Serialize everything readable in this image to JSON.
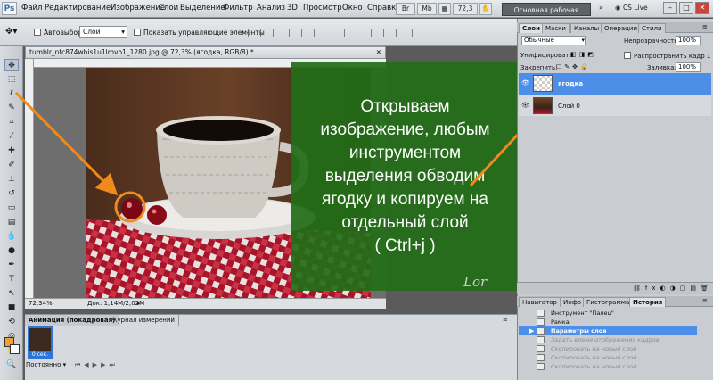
{
  "app": {
    "logo": "Ps"
  },
  "menu": [
    "Файл",
    "Редактирование",
    "Изображение",
    "Слои",
    "Выделение",
    "Фильтр",
    "Анализ",
    "3D",
    "Просмотр",
    "Окно",
    "Справка"
  ],
  "menubar_controls": {
    "zoom": "72,3"
  },
  "workspace": "Основная рабочая среда",
  "cs_live": "CS Live",
  "options": {
    "auto_select_label": "Автовыбор:",
    "auto_select_value": "Слой",
    "show_controls_label": "Показать управляющие элементы"
  },
  "document": {
    "tab_title": "tumblr_nfc874whis1u1lmvo1_1280.jpg @ 72,3% (ягодка, RGB/8) *",
    "zoom": "72,34%",
    "doc_size": "Док: 1,14М/2,02М",
    "signature": "Lor"
  },
  "note": {
    "lines": [
      "Открываем",
      "изображение, любым",
      "инструментом",
      "выделения обводим",
      "ягодку и копируем на",
      "отдельный слой",
      "( Ctrl+j )"
    ],
    "background": "#226e18"
  },
  "annotation_color": "#f08a1c",
  "animation_panel": {
    "tabs": [
      "Анимация (покадровая)",
      "Журнал измерений"
    ],
    "frame_label": "0 сек.",
    "loop": "Постоянно"
  },
  "layers_panel": {
    "tabs": [
      "Слои",
      "Маски",
      "Каналы",
      "Операции",
      "Стили"
    ],
    "blend_mode": "Обычные",
    "opacity_label": "Непрозрачность:",
    "opacity": "100%",
    "unify_label": "Унифицировать:",
    "propagate_label": "Распространить кадр 1",
    "lock_label": "Закрепить:",
    "fill_label": "Заливка:",
    "fill": "100%",
    "layers": [
      {
        "name": "ягодка",
        "selected": true
      },
      {
        "name": "Слой 0",
        "selected": false
      }
    ]
  },
  "history_panel": {
    "tabs": [
      "Навигатор",
      "Инфо",
      "Гистограмма",
      "История"
    ],
    "items": [
      {
        "label": "Инструмент \"Палец\"",
        "state": "normal"
      },
      {
        "label": "Рамка",
        "state": "normal"
      },
      {
        "label": "Параметры слоя",
        "state": "selected"
      },
      {
        "label": "Задать время отображения кадров",
        "state": "dimmed"
      },
      {
        "label": "Скопировать на новый слой",
        "state": "dimmed"
      },
      {
        "label": "Скопировать на новый слой",
        "state": "dimmed"
      },
      {
        "label": "Скопировать на новый слой",
        "state": "dimmed"
      }
    ]
  }
}
